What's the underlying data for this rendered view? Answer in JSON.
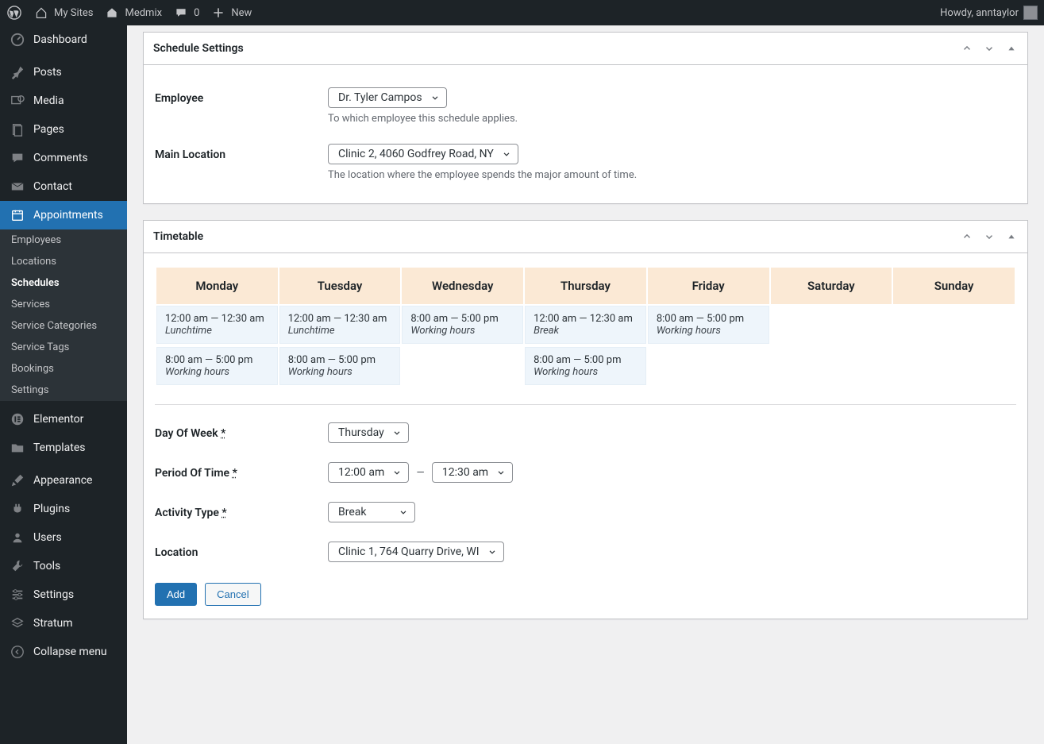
{
  "adminbar": {
    "my_sites": "My Sites",
    "site_name": "Medmix",
    "comments": "0",
    "new": "New",
    "howdy": "Howdy, anntaylor"
  },
  "menu": {
    "dashboard": "Dashboard",
    "posts": "Posts",
    "media": "Media",
    "pages": "Pages",
    "comments": "Comments",
    "contact": "Contact",
    "appointments": "Appointments",
    "submenu": {
      "employees": "Employees",
      "locations": "Locations",
      "schedules": "Schedules",
      "services": "Services",
      "service_categories": "Service Categories",
      "service_tags": "Service Tags",
      "bookings": "Bookings",
      "settings": "Settings"
    },
    "elementor": "Elementor",
    "templates": "Templates",
    "appearance": "Appearance",
    "plugins": "Plugins",
    "users": "Users",
    "tools": "Tools",
    "settings": "Settings",
    "stratum": "Stratum",
    "collapse": "Collapse menu"
  },
  "schedule": {
    "title": "Schedule Settings",
    "employee_label": "Employee",
    "employee_value": "Dr. Tyler Campos",
    "employee_desc": "To which employee this schedule applies.",
    "location_label": "Main Location",
    "location_value": "Clinic 2, 4060 Godfrey Road, NY",
    "location_desc": "The location where the employee spends the major amount of time."
  },
  "timetable": {
    "title": "Timetable",
    "days": [
      "Monday",
      "Tuesday",
      "Wednesday",
      "Thursday",
      "Friday",
      "Saturday",
      "Sunday"
    ],
    "cells": {
      "mon": [
        {
          "time": "12:00 am — 12:30 am",
          "label": "Lunchtime"
        },
        {
          "time": "8:00 am — 5:00 pm",
          "label": "Working hours"
        }
      ],
      "tue": [
        {
          "time": "12:00 am — 12:30 am",
          "label": "Lunchtime"
        },
        {
          "time": "8:00 am — 5:00 pm",
          "label": "Working hours"
        }
      ],
      "wed": [
        {
          "time": "8:00 am — 5:00 pm",
          "label": "Working hours"
        }
      ],
      "thu": [
        {
          "time": "12:00 am — 12:30 am",
          "label": "Break"
        },
        {
          "time": "8:00 am — 5:00 pm",
          "label": "Working hours"
        }
      ],
      "fri": [
        {
          "time": "8:00 am — 5:00 pm",
          "label": "Working hours"
        }
      ]
    },
    "form": {
      "dow_label": "Day Of Week",
      "dow_value": "Thursday",
      "period_label": "Period Of Time",
      "period_from": "12:00 am",
      "period_to": "12:30 am",
      "activity_label": "Activity Type",
      "activity_value": "Break",
      "location_label": "Location",
      "location_value": "Clinic 1, 764 Quarry Drive, WI",
      "add": "Add",
      "cancel": "Cancel",
      "required": "*"
    }
  }
}
